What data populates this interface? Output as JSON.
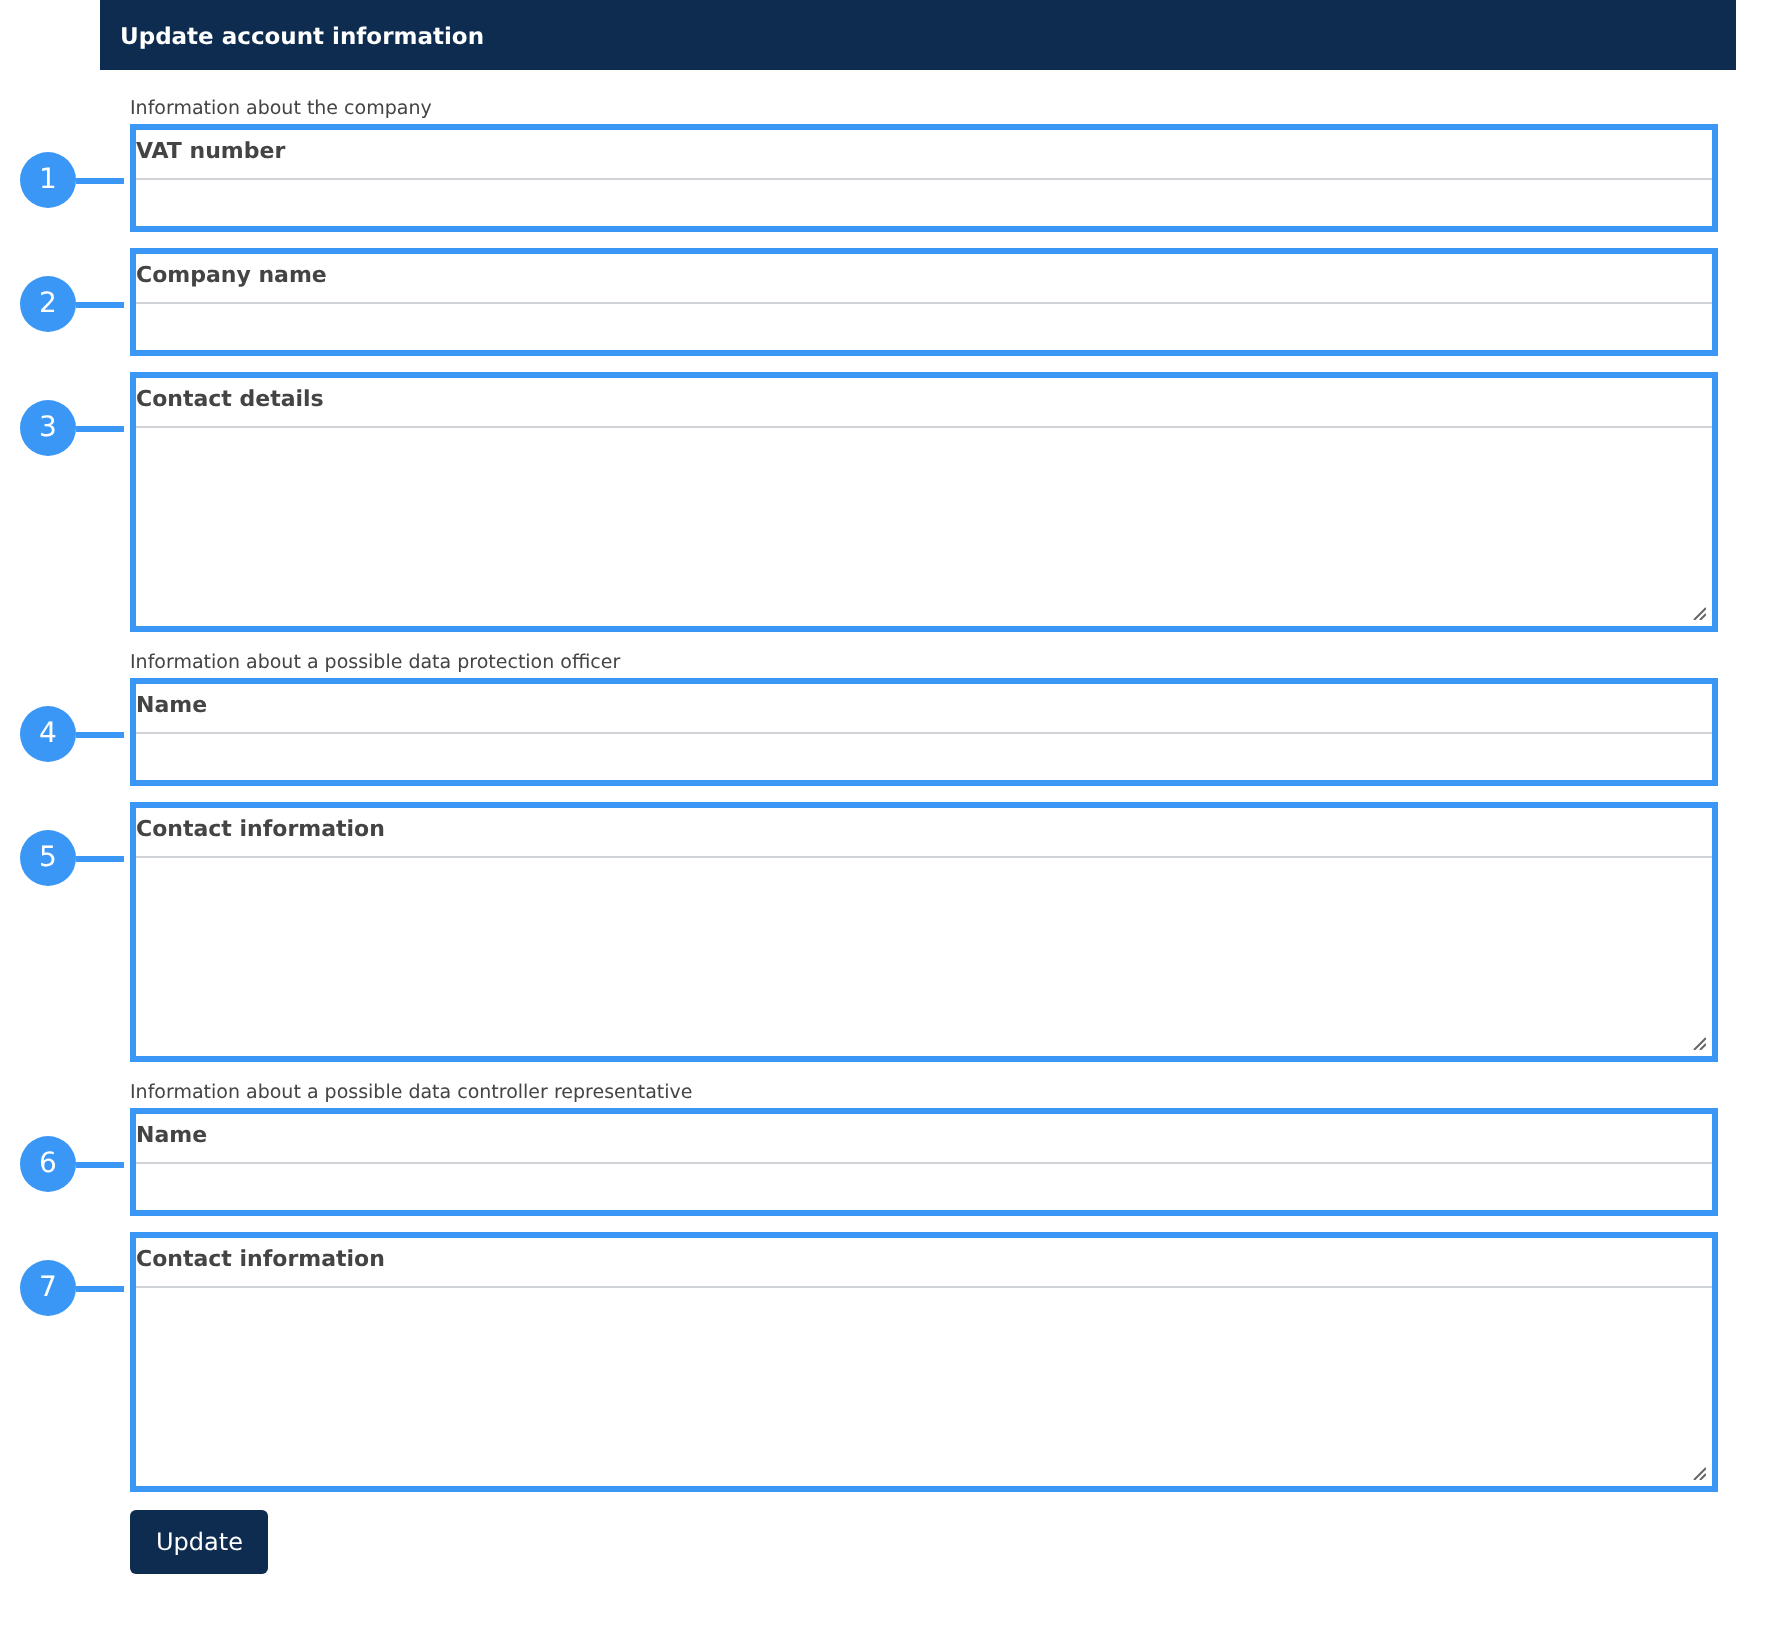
{
  "header": {
    "title": "Update account information"
  },
  "sections": [
    {
      "heading": "Information about the company",
      "fields": [
        {
          "callout": "1",
          "label": "VAT number",
          "kind": "input"
        },
        {
          "callout": "2",
          "label": "Company name",
          "kind": "input"
        },
        {
          "callout": "3",
          "label": "Contact details",
          "kind": "textarea"
        }
      ]
    },
    {
      "heading": "Information about a possible data protection officer",
      "fields": [
        {
          "callout": "4",
          "label": "Name",
          "kind": "input"
        },
        {
          "callout": "5",
          "label": "Contact information",
          "kind": "textarea"
        }
      ]
    },
    {
      "heading": "Information about a possible data controller representative",
      "fields": [
        {
          "callout": "6",
          "label": "Name",
          "kind": "input"
        },
        {
          "callout": "7",
          "label": "Contact information",
          "kind": "textarea"
        }
      ]
    }
  ],
  "submit": {
    "label": "Update"
  }
}
